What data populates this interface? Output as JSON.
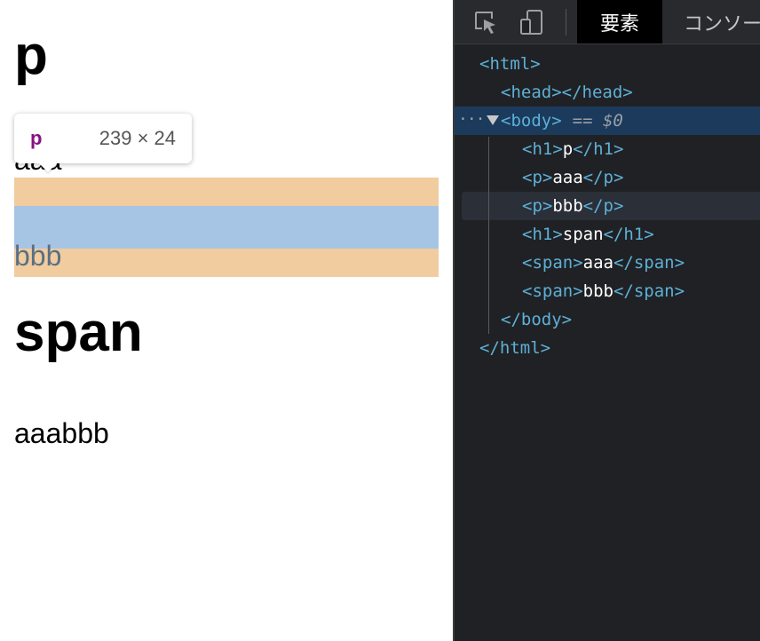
{
  "page": {
    "heading_p": "p",
    "para_aaa": "aaa",
    "para_bbb": "bbb",
    "heading_span": "span",
    "spans_text": "aaabbb"
  },
  "tooltip": {
    "tag": "p",
    "size": "239 × 24"
  },
  "devtools": {
    "tabs": {
      "elements": "要素",
      "console": "コンソー"
    },
    "icons": [
      "inspect-element-icon",
      "device-toolbar-icon"
    ],
    "dom": {
      "html_open": "<html>",
      "head": "<head></head>",
      "body_open": "<body>",
      "selected_marker": "== $0",
      "ellipsis": "···",
      "h1_open": "<h1>",
      "h1_text": "p",
      "h1_close": "</h1>",
      "p1_open": "<p>",
      "p1_text": "aaa",
      "p1_close": "</p>",
      "p2_open": "<p>",
      "p2_text": "bbb",
      "p2_close": "</p>",
      "h1b_open": "<h1>",
      "h1b_text": "span",
      "h1b_close": "</h1>",
      "span1_open": "<span>",
      "span1_text": "aaa",
      "span1_close": "</span>",
      "span2_open": "<span>",
      "span2_text": "bbb",
      "span2_close": "</span>",
      "body_close": "</body>",
      "html_close": "</html>"
    }
  },
  "colors": {
    "margin_highlight": "#f0cc9e",
    "content_highlight": "#a6c4e4",
    "tag_color": "#5db0d7",
    "selected_row": "#1b3a5c",
    "tooltip_tag": "#881280"
  }
}
